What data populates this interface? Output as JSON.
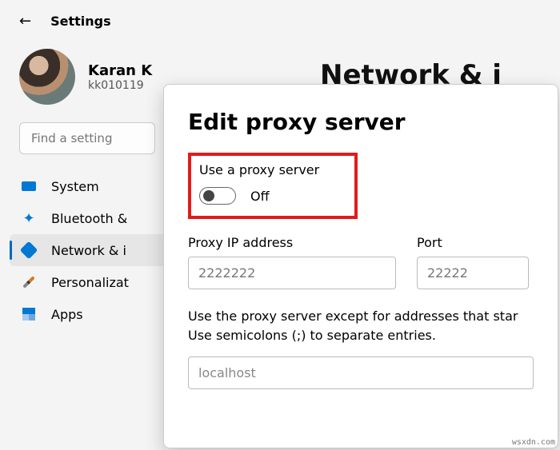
{
  "header": {
    "title": "Settings"
  },
  "user": {
    "name": "Karan K",
    "email": "kk010119"
  },
  "search": {
    "placeholder": "Find a setting"
  },
  "sidebar": {
    "items": [
      {
        "label": "System"
      },
      {
        "label": "Bluetooth &"
      },
      {
        "label": "Network & i"
      },
      {
        "label": "Personalizat"
      },
      {
        "label": "Apps"
      }
    ]
  },
  "page": {
    "title": "Network & i"
  },
  "dialog": {
    "title": "Edit proxy server",
    "use_proxy_label": "Use a proxy server",
    "toggle_state": "Off",
    "ip_label": "Proxy IP address",
    "ip_value": "2222222",
    "port_label": "Port",
    "port_value": "22222",
    "help_line1": "Use the proxy server except for addresses that star",
    "help_line2": "Use semicolons (;) to separate entries.",
    "exceptions_value": "localhost"
  },
  "watermark": "wsxdn.com"
}
